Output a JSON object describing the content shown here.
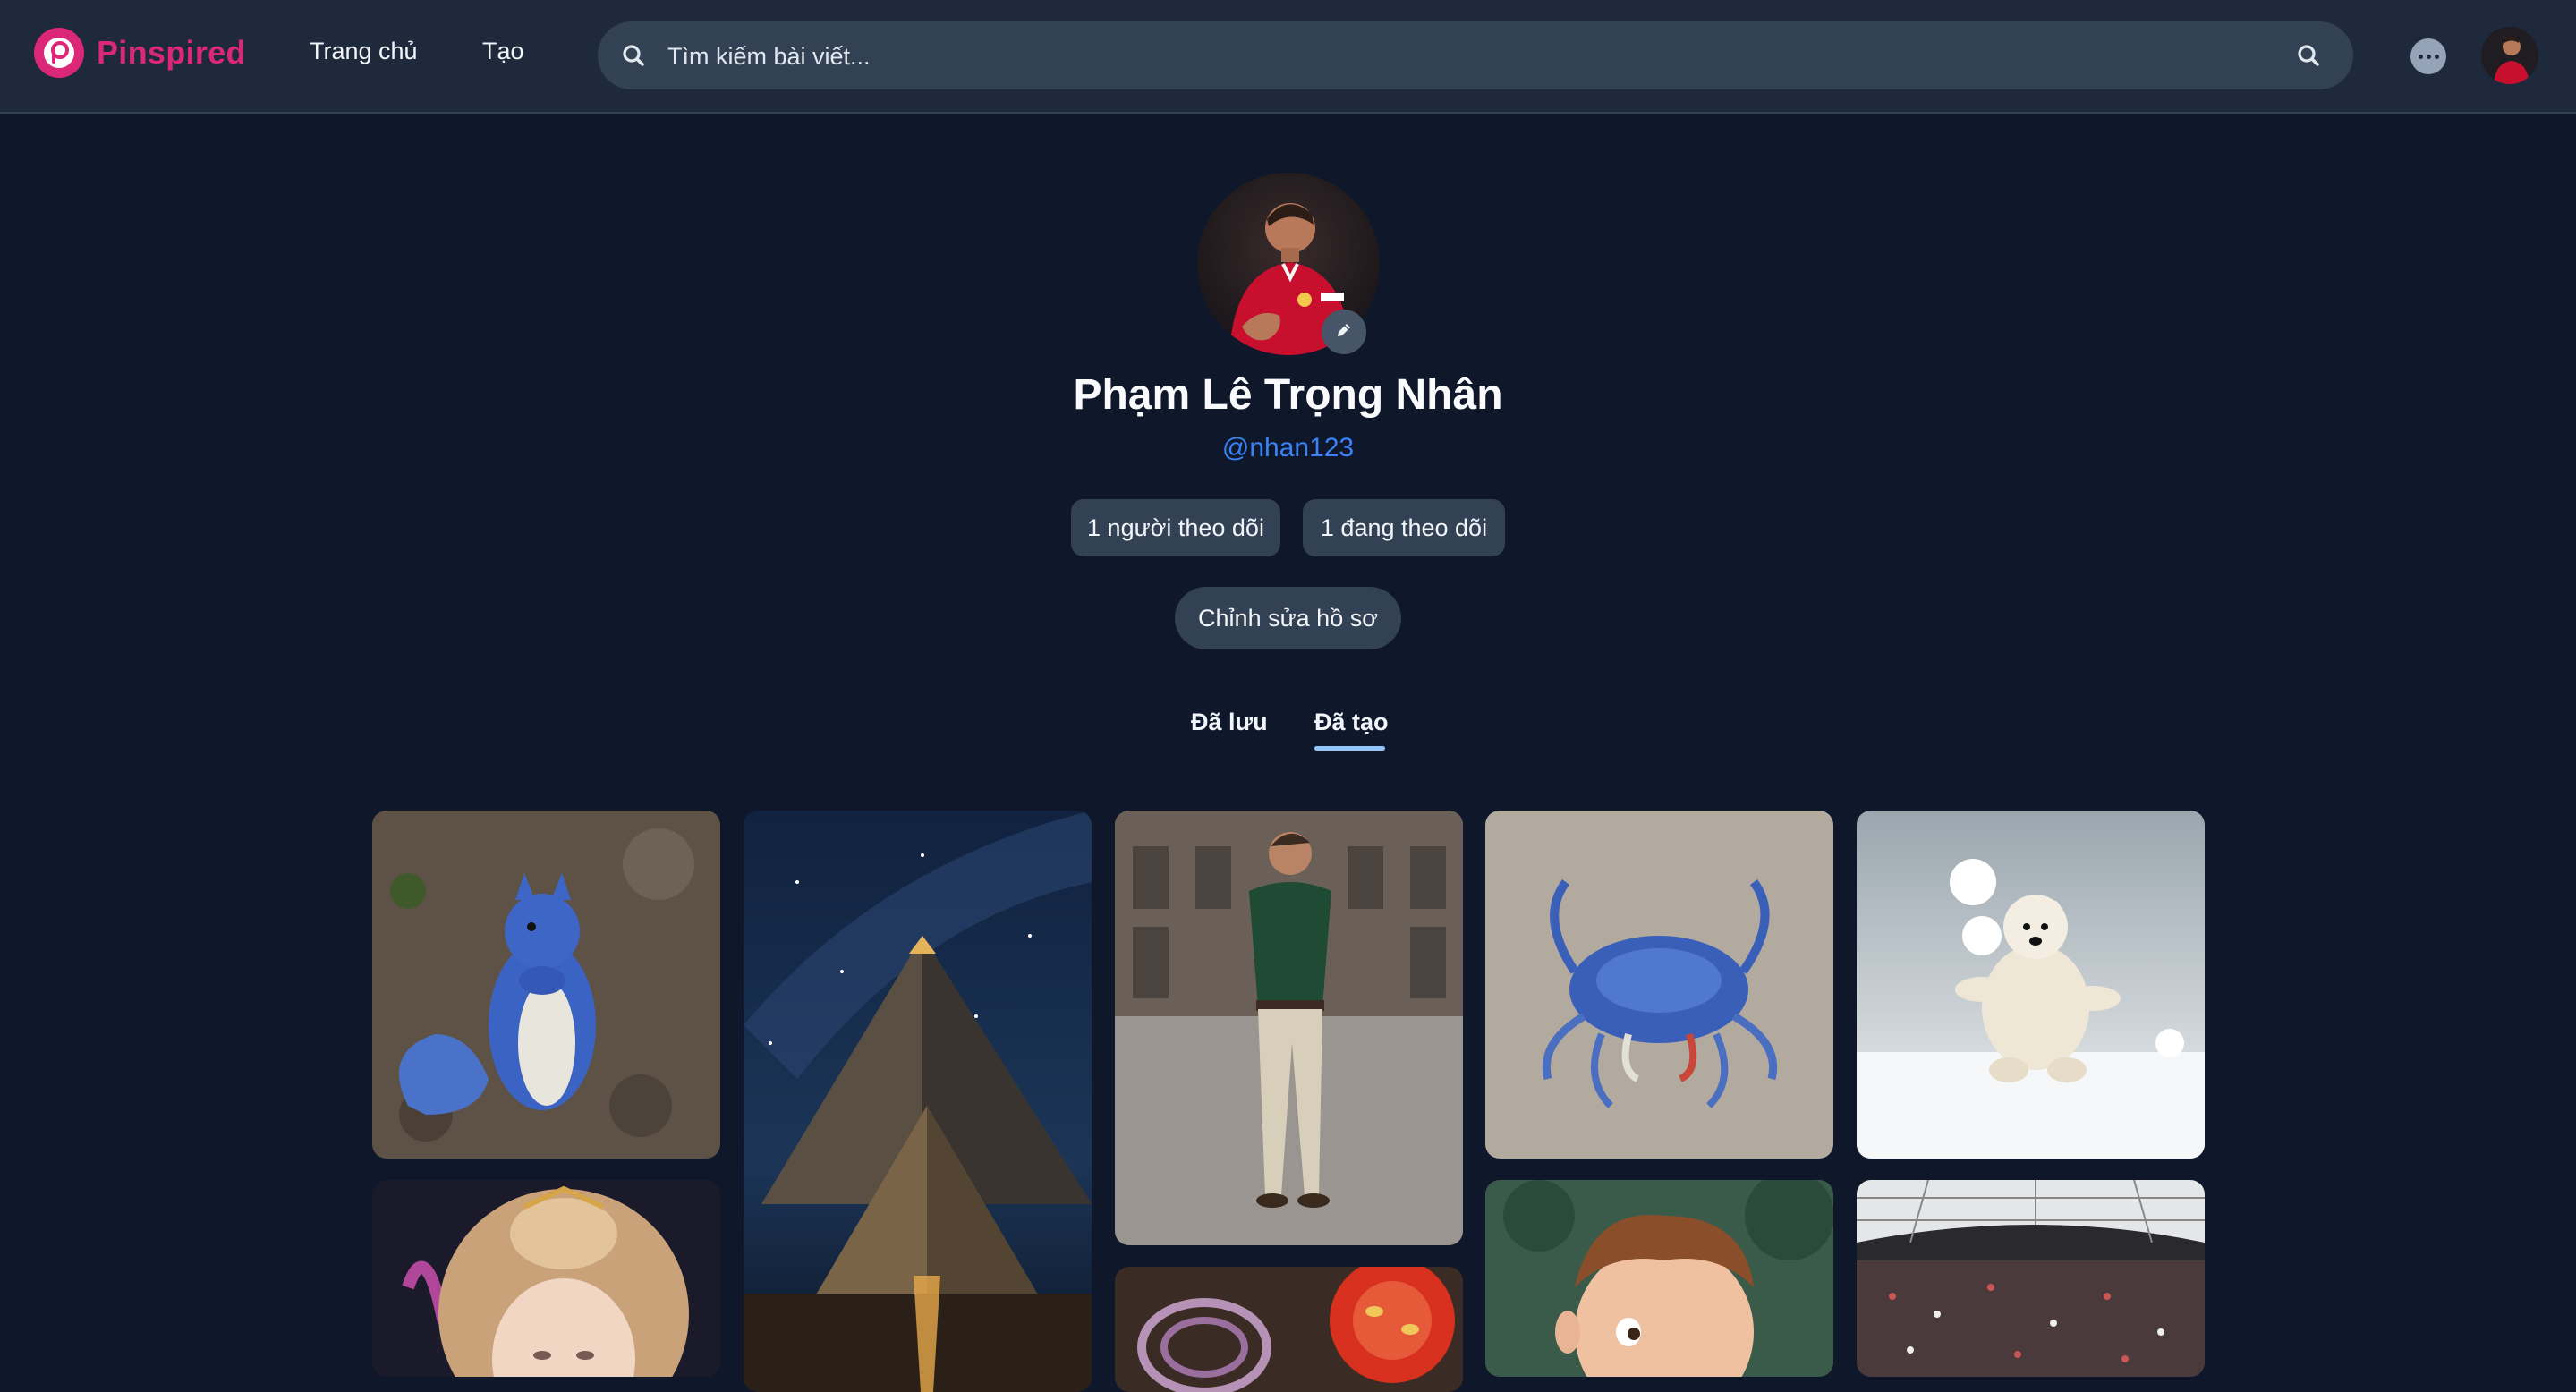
{
  "header": {
    "logo_text": "Pinspired",
    "nav": {
      "home": "Trang chủ",
      "create": "Tạo"
    },
    "search": {
      "placeholder": "Tìm kiếm bài viết...",
      "value": ""
    },
    "icons": {
      "search_left": "search-icon",
      "search_right": "search-icon",
      "chat": "chat-bubble-icon",
      "avatar": "user-avatar"
    }
  },
  "profile": {
    "name": "Phạm Lê Trọng Nhân",
    "handle": "@nhan123",
    "followers_label": "1 người theo dõi",
    "following_label": "1 đang theo dõi",
    "edit_profile_label": "Chỉnh sửa hồ sơ",
    "edit_avatar_icon": "pencil-icon"
  },
  "tabs": {
    "saved": "Đã lưu",
    "created": "Đã tạo",
    "active": "created"
  },
  "pins": [
    {
      "subject": "blue squirrel"
    },
    {
      "subject": "illustrated girl with golden hair"
    },
    {
      "subject": "pyramids under milky way"
    },
    {
      "subject": "man in green shirt walking"
    },
    {
      "subject": "onion and tomato slices"
    },
    {
      "subject": "blue crab on sand"
    },
    {
      "subject": "cartoon boy with brown hair"
    },
    {
      "subject": "polar bear in snow"
    },
    {
      "subject": "stadium with crowd"
    }
  ],
  "colors": {
    "background": "#0f172a",
    "header": "#1e293b",
    "brand": "#db2777",
    "handle": "#3b82f6",
    "pill": "#334155",
    "tab_indicator": "#93c5fd"
  }
}
